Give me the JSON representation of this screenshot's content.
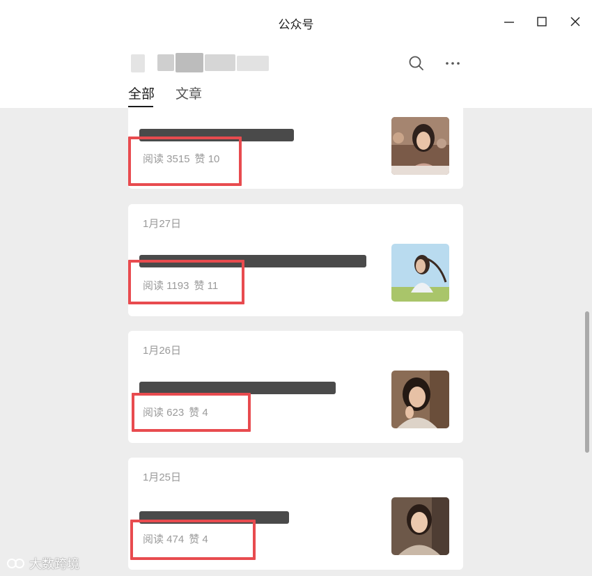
{
  "window": {
    "title": "公众号"
  },
  "header": {
    "tabs": [
      {
        "label": "全部",
        "active": true
      },
      {
        "label": "文章",
        "active": false
      }
    ]
  },
  "articles": [
    {
      "date": "",
      "reads": "阅读 3515",
      "likes": "赞 10",
      "thumb": "woman-smiling-office-photo"
    },
    {
      "date": "1月27日",
      "reads": "阅读 1193",
      "likes": "赞 11",
      "thumb": "woman-field-sky-photo"
    },
    {
      "date": "1月26日",
      "reads": "阅读 623",
      "likes": "赞 4",
      "thumb": "woman-thinking-photo"
    },
    {
      "date": "1月25日",
      "reads": "阅读 474",
      "likes": "赞 4",
      "thumb": "woman-portrait-photo"
    }
  ],
  "watermark": {
    "text": "大数跨境"
  },
  "colors": {
    "highlight": "#e84b4f",
    "background": "#ededed",
    "card": "#ffffff"
  }
}
